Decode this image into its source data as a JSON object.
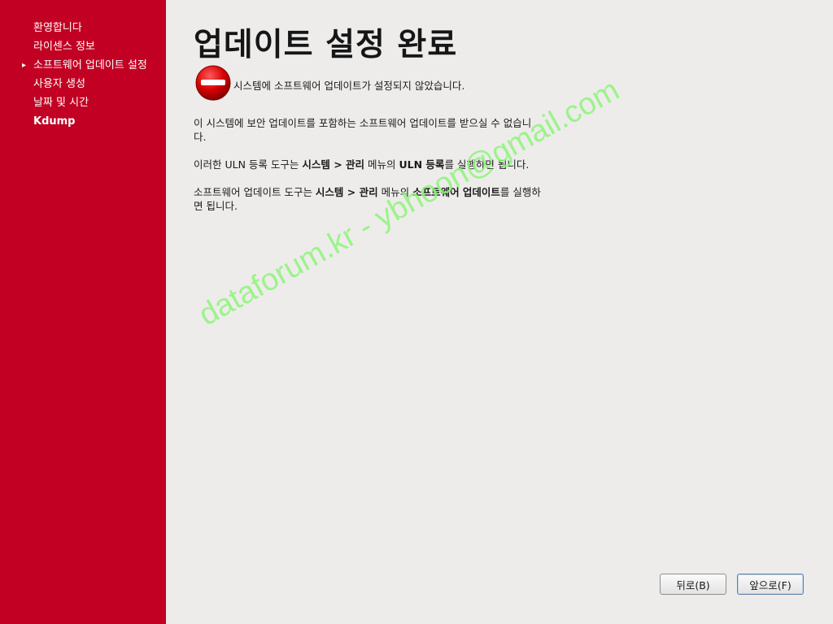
{
  "sidebar": {
    "items": [
      {
        "label": "환영합니다"
      },
      {
        "label": "라이센스 정보"
      },
      {
        "label": "소프트웨어 업데이트 설정"
      },
      {
        "label": "사용자 생성"
      },
      {
        "label": "날짜 및 시간"
      },
      {
        "label": "Kdump"
      }
    ],
    "current_arrow": "▸"
  },
  "main": {
    "title": "업데이트 설정 완료",
    "status_icon": "stop-icon",
    "status_text": "시스템에 소프트웨어 업데이트가 설정되지 않았습니다.",
    "para1": "이 시스템에 보안 업데이트를 포함하는 소프트웨어 업데이트를 받으실 수 없습니다.",
    "para2": {
      "t1": "이러한 ULN 등록 도구는 ",
      "b1": "시스템 > 관리",
      "t2": " 메뉴의 ",
      "b2": "ULN 등록",
      "t3": "를 실행하면 됩니다."
    },
    "para3": {
      "t1": "소프트웨어 업데이트 도구는 ",
      "b1": "시스템 > 관리",
      "t2": " 메뉴의 ",
      "b2": "소프트웨어 업데이트",
      "t3": "를 실행하면 됩니다."
    }
  },
  "watermark": "dataforum.kr - ybhoon@gmail.com",
  "buttons": {
    "back": "뒤로(B)",
    "forward": "앞으로(F)"
  },
  "colors": {
    "sidebar_bg": "#c10023",
    "content_bg": "#edeceb",
    "watermark": "#8ef57a"
  }
}
